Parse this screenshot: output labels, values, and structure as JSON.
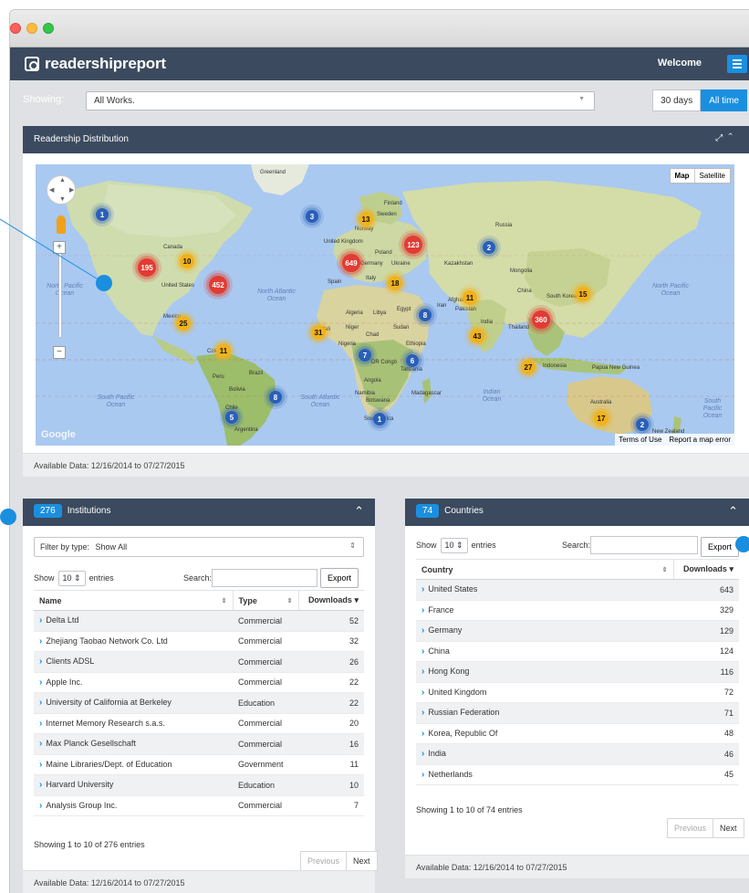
{
  "app": {
    "brand": "readershipreport",
    "welcome": "Welcome"
  },
  "filter_bar": {
    "label": "Showing:",
    "selected_work": "All Works.",
    "range_30": "30 days",
    "range_all": "All time"
  },
  "map_panel": {
    "title": "Readership Distribution",
    "toggle_map": "Map",
    "toggle_satellite": "Satellite",
    "google": "Google",
    "terms": "Terms of Use",
    "report": "Report a map error",
    "available": "Available Data: 12/16/2014 to 07/27/2015",
    "clusters": [
      {
        "value": "1",
        "color": "blue"
      },
      {
        "value": "195",
        "color": "red"
      },
      {
        "value": "10",
        "color": "yellow"
      },
      {
        "value": "452",
        "color": "red"
      },
      {
        "value": "25",
        "color": "yellow"
      },
      {
        "value": "11",
        "color": "yellow"
      },
      {
        "value": "5",
        "color": "blue"
      },
      {
        "value": "8",
        "color": "blue"
      },
      {
        "value": "3",
        "color": "blue"
      },
      {
        "value": "13",
        "color": "yellow"
      },
      {
        "value": "649",
        "color": "red"
      },
      {
        "value": "123",
        "color": "red"
      },
      {
        "value": "18",
        "color": "yellow"
      },
      {
        "value": "31",
        "color": "yellow"
      },
      {
        "value": "7",
        "color": "blue"
      },
      {
        "value": "6",
        "color": "blue"
      },
      {
        "value": "1",
        "color": "blue"
      },
      {
        "value": "2",
        "color": "blue"
      },
      {
        "value": "8",
        "color": "blue"
      },
      {
        "value": "11",
        "color": "yellow"
      },
      {
        "value": "43",
        "color": "yellow"
      },
      {
        "value": "360",
        "color": "red"
      },
      {
        "value": "15",
        "color": "yellow"
      },
      {
        "value": "27",
        "color": "yellow"
      },
      {
        "value": "17",
        "color": "yellow"
      },
      {
        "value": "2",
        "color": "blue"
      }
    ],
    "labels": {
      "greenland": "Greenland",
      "canada": "Canada",
      "us": "United States",
      "mexico": "Mexico",
      "colombia": "Colombia",
      "peru": "Peru",
      "brazil": "Brazil",
      "bolivia": "Bolivia",
      "chile": "Chile",
      "argentina": "Argentina",
      "finland": "Finland",
      "norway": "Norway",
      "sweden": "Sweden",
      "uk": "United Kingdom",
      "poland": "Poland",
      "germany": "Germany",
      "ukraine": "Ukraine",
      "spain": "Spain",
      "italy": "Italy",
      "kazakhstan": "Kazakhstan",
      "russia": "Russia",
      "mongolia": "Mongolia",
      "china": "China",
      "southkorea": "South Korea",
      "afghan": "Afghan",
      "iran": "Iran",
      "pakistan": "Pakistan",
      "india": "India",
      "thailand": "Thailand",
      "algeria": "Algeria",
      "libya": "Libya",
      "egypt": "Egypt",
      "mali": "Mali",
      "niger": "Niger",
      "chad": "Chad",
      "sudan": "Sudan",
      "nigeria": "Nigeria",
      "ethiopia": "Ethiopia",
      "drc": "DR Congo",
      "tanzania": "Tanzania",
      "angola": "Angola",
      "namibia": "Namibia",
      "botswana": "Botswana",
      "madagascar": "Madagascar",
      "southafrica": "South Africa",
      "indonesia": "Indonesia",
      "png": "Papua New Guinea",
      "australia": "Australia",
      "nz": "New Zealand",
      "n_pacific": "North Pacific Ocean",
      "n_atlantic": "North Atlantic Ocean",
      "s_pacific": "South Pacific Ocean",
      "s_atlantic": "South Atlantic Ocean",
      "indian": "Indian Ocean",
      "n_pacific_r": "North Pacific Ocean",
      "s_pacific_r": "South Pacific Ocean"
    }
  },
  "institutions": {
    "count": "276",
    "title": "Institutions",
    "filter_label": "Filter by type:",
    "filter_value": "Show All",
    "show": "Show",
    "entries_value": "10",
    "entries": "entries",
    "search": "Search:",
    "export": "Export",
    "columns": [
      "Name",
      "Type",
      "Downloads"
    ],
    "rows": [
      {
        "name": "Delta Ltd",
        "type": "Commercial",
        "downloads": "52"
      },
      {
        "name": "Zhejiang Taobao Network Co. Ltd",
        "type": "Commercial",
        "downloads": "32"
      },
      {
        "name": "Clients ADSL",
        "type": "Commercial",
        "downloads": "26"
      },
      {
        "name": "Apple Inc.",
        "type": "Commercial",
        "downloads": "22"
      },
      {
        "name": "University of California at Berkeley",
        "type": "Education",
        "downloads": "22"
      },
      {
        "name": "Internet Memory Research s.a.s.",
        "type": "Commercial",
        "downloads": "20"
      },
      {
        "name": "Max Planck Gesellschaft",
        "type": "Commercial",
        "downloads": "16"
      },
      {
        "name": "Maine Libraries/Dept. of Education",
        "type": "Government",
        "downloads": "11"
      },
      {
        "name": "Harvard University",
        "type": "Education",
        "downloads": "10"
      },
      {
        "name": "Analysis Group Inc.",
        "type": "Commercial",
        "downloads": "7"
      }
    ],
    "info": "Showing 1 to 10 of 276 entries",
    "prev": "Previous",
    "next": "Next",
    "available": "Available Data: 12/16/2014 to 07/27/2015"
  },
  "countries": {
    "count": "74",
    "title": "Countries",
    "show": "Show",
    "entries_value": "10",
    "entries": "entries",
    "search": "Search:",
    "export": "Export",
    "columns": [
      "Country",
      "Downloads"
    ],
    "rows": [
      {
        "name": "United States",
        "downloads": "643"
      },
      {
        "name": "France",
        "downloads": "329"
      },
      {
        "name": "Germany",
        "downloads": "129"
      },
      {
        "name": "China",
        "downloads": "124"
      },
      {
        "name": "Hong Kong",
        "downloads": "116"
      },
      {
        "name": "United Kingdom",
        "downloads": "72"
      },
      {
        "name": "Russian Federation",
        "downloads": "71"
      },
      {
        "name": "Korea, Republic Of",
        "downloads": "48"
      },
      {
        "name": "India",
        "downloads": "46"
      },
      {
        "name": "Netherlands",
        "downloads": "45"
      }
    ],
    "info": "Showing 1 to 10 of 74 entries",
    "prev": "Previous",
    "next": "Next",
    "available": "Available Data: 12/16/2014 to 07/27/2015"
  },
  "colors": {
    "header": "#3b4a5e",
    "accent": "#1a8fe0",
    "cluster_red": "#e23b33",
    "cluster_yellow": "#f2b21a",
    "cluster_blue": "#2a5fb8"
  }
}
